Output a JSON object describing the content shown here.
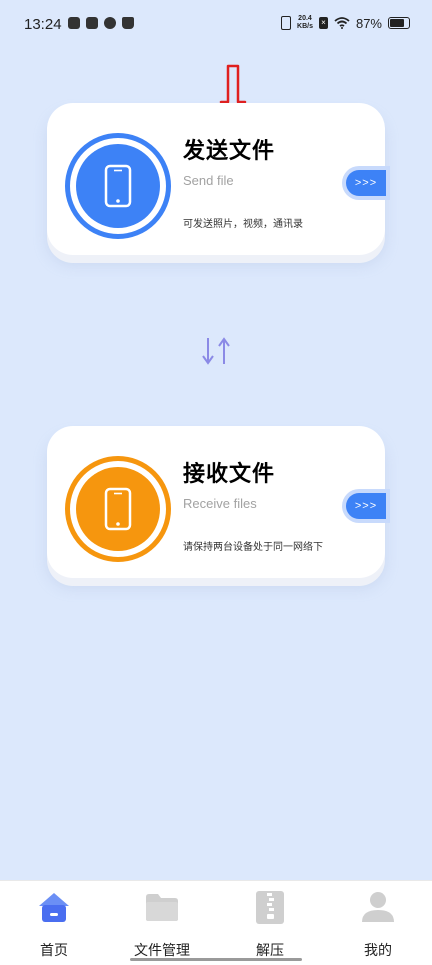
{
  "status_bar": {
    "time": "13:24",
    "net_speed_value": "20.4",
    "net_speed_unit": "KB/s",
    "battery": "87%"
  },
  "send_card": {
    "title": "发送文件",
    "subtitle": "Send file",
    "description": "可发送照片，视频，通讯录",
    "go_label": ">>>",
    "accent": "#3d82f6",
    "icon": "phone-icon"
  },
  "receive_card": {
    "title": "接收文件",
    "subtitle": "Receive files",
    "description": "请保持两台设备处于同一网络下",
    "go_label": ">>>",
    "accent": "#f6960e",
    "icon": "phone-icon"
  },
  "bottom_nav": {
    "items": [
      {
        "label": "首页",
        "icon": "home-icon",
        "active": true
      },
      {
        "label": "文件管理",
        "icon": "folder-icon",
        "active": false
      },
      {
        "label": "解压",
        "icon": "zip-icon",
        "active": false
      },
      {
        "label": "我的",
        "icon": "user-icon",
        "active": false
      }
    ]
  },
  "colors": {
    "background": "#dce8fc",
    "nav_active": "#4a6ef0",
    "nav_inactive": "#cfcfcf"
  }
}
